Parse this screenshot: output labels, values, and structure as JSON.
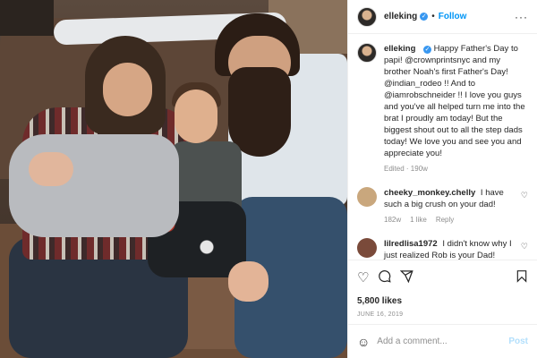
{
  "post": {
    "username": "elleking",
    "follow_label": "Follow",
    "more_icon": "more-horizontal-icon",
    "caption": {
      "username": "elleking",
      "text": "Happy Father's Day to papi! @crownprintsnyc and my brother Noah's first Father's Day! @indian_rodeo !! And to @iamrobschneider !! I love you guys and you've all helped turn me into the brat I proudly am today! But the biggest shout out to all the step dads today! We love you and see you and appreciate you!",
      "meta": "Edited · 190w"
    },
    "comments": [
      {
        "username": "cheeky_monkey.chelly",
        "text": "I have such a big crush on your dad!",
        "time": "182w",
        "likes": "1 like",
        "reply": "Reply",
        "avatar_color": "#c9a77d"
      },
      {
        "username": "lilredlisa1972",
        "text": "I didn't know why I just realized Rob is your Dad! Love him",
        "time": "",
        "likes": "",
        "reply": "",
        "avatar_color": "#7a4a3a"
      }
    ],
    "likes": "5,800 likes",
    "date": "JUNE 16, 2019",
    "add_comment_placeholder": "Add a comment...",
    "post_label": "Post"
  },
  "colors": {
    "accent": "#0095f6",
    "post_disabled": "#b2dffc"
  }
}
